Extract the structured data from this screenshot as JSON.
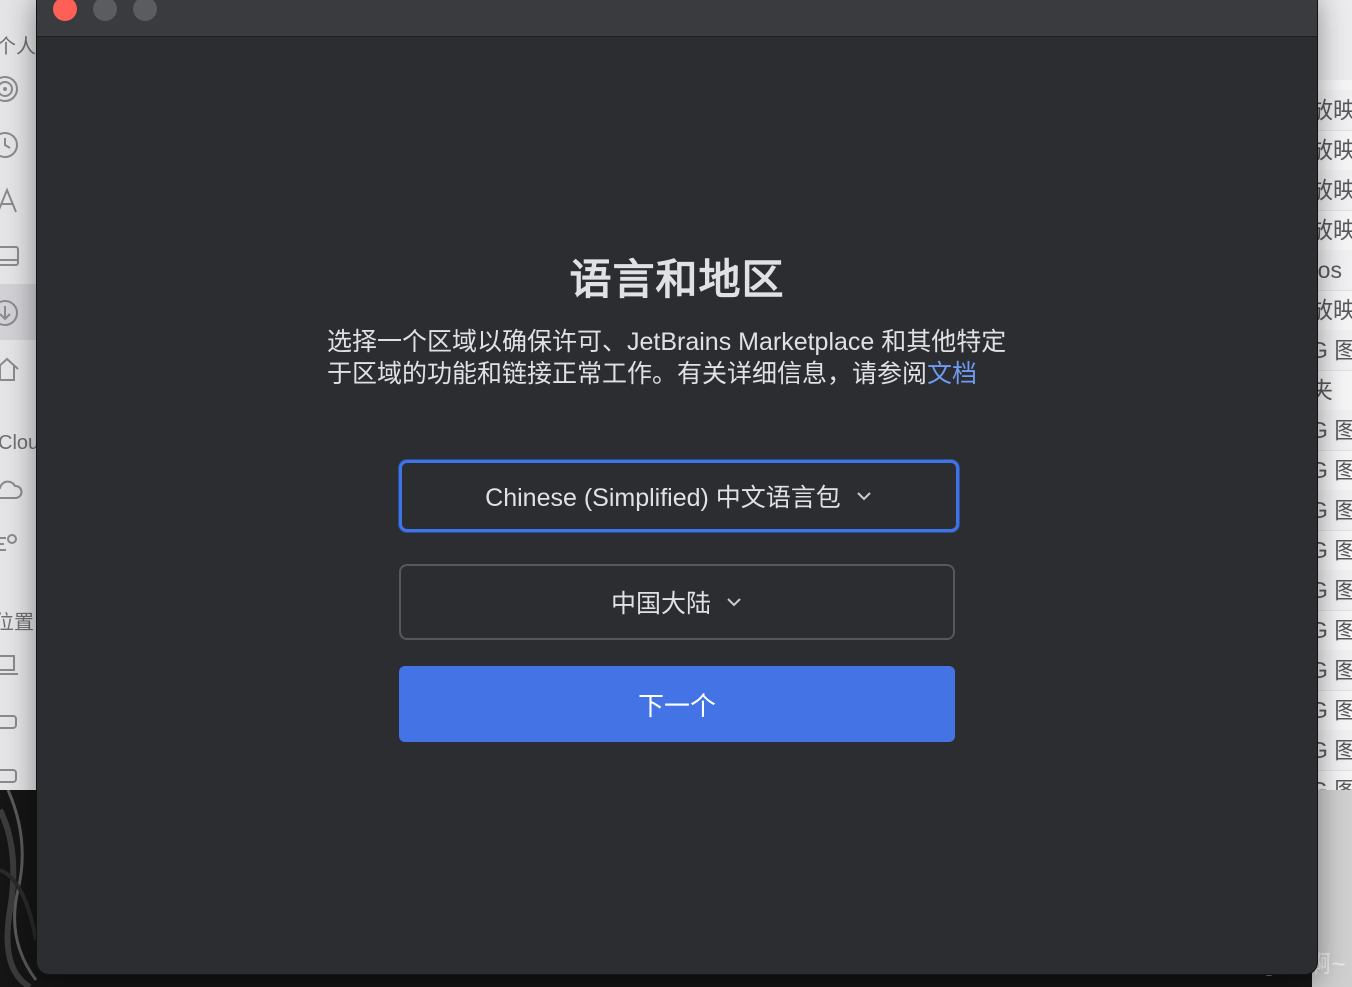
{
  "background": {
    "left_sidebar": {
      "labels": [
        "个人",
        "Clou",
        "位置"
      ]
    },
    "right_list": {
      "items": [
        "放映",
        "放映",
        "放映",
        "放映",
        "ros",
        "放映",
        "G 图",
        "夹",
        "G 图",
        "G 图",
        "G 图",
        "G 图",
        "G 图",
        "G 图",
        "G 图",
        "G 图",
        "G 图",
        "G 图"
      ]
    },
    "watermark": "CSDN @桑啊~"
  },
  "dialog": {
    "title": "语言和地区",
    "description": "选择一个区域以确保许可、JetBrains Marketplace 和其他特定于区域的功能和链接正常工作。有关详细信息，请参阅",
    "doc_link": "文档",
    "language_select": {
      "value": "Chinese (Simplified) 中文语言包",
      "icon": "chevron-down-icon"
    },
    "region_select": {
      "value": "中国大陆",
      "icon": "chevron-down-icon"
    },
    "next_button": "下一个"
  },
  "colors": {
    "window_bg": "#2b2d30",
    "accent": "#4473e6",
    "link": "#6f9bf2",
    "close": "#fe5f57"
  }
}
